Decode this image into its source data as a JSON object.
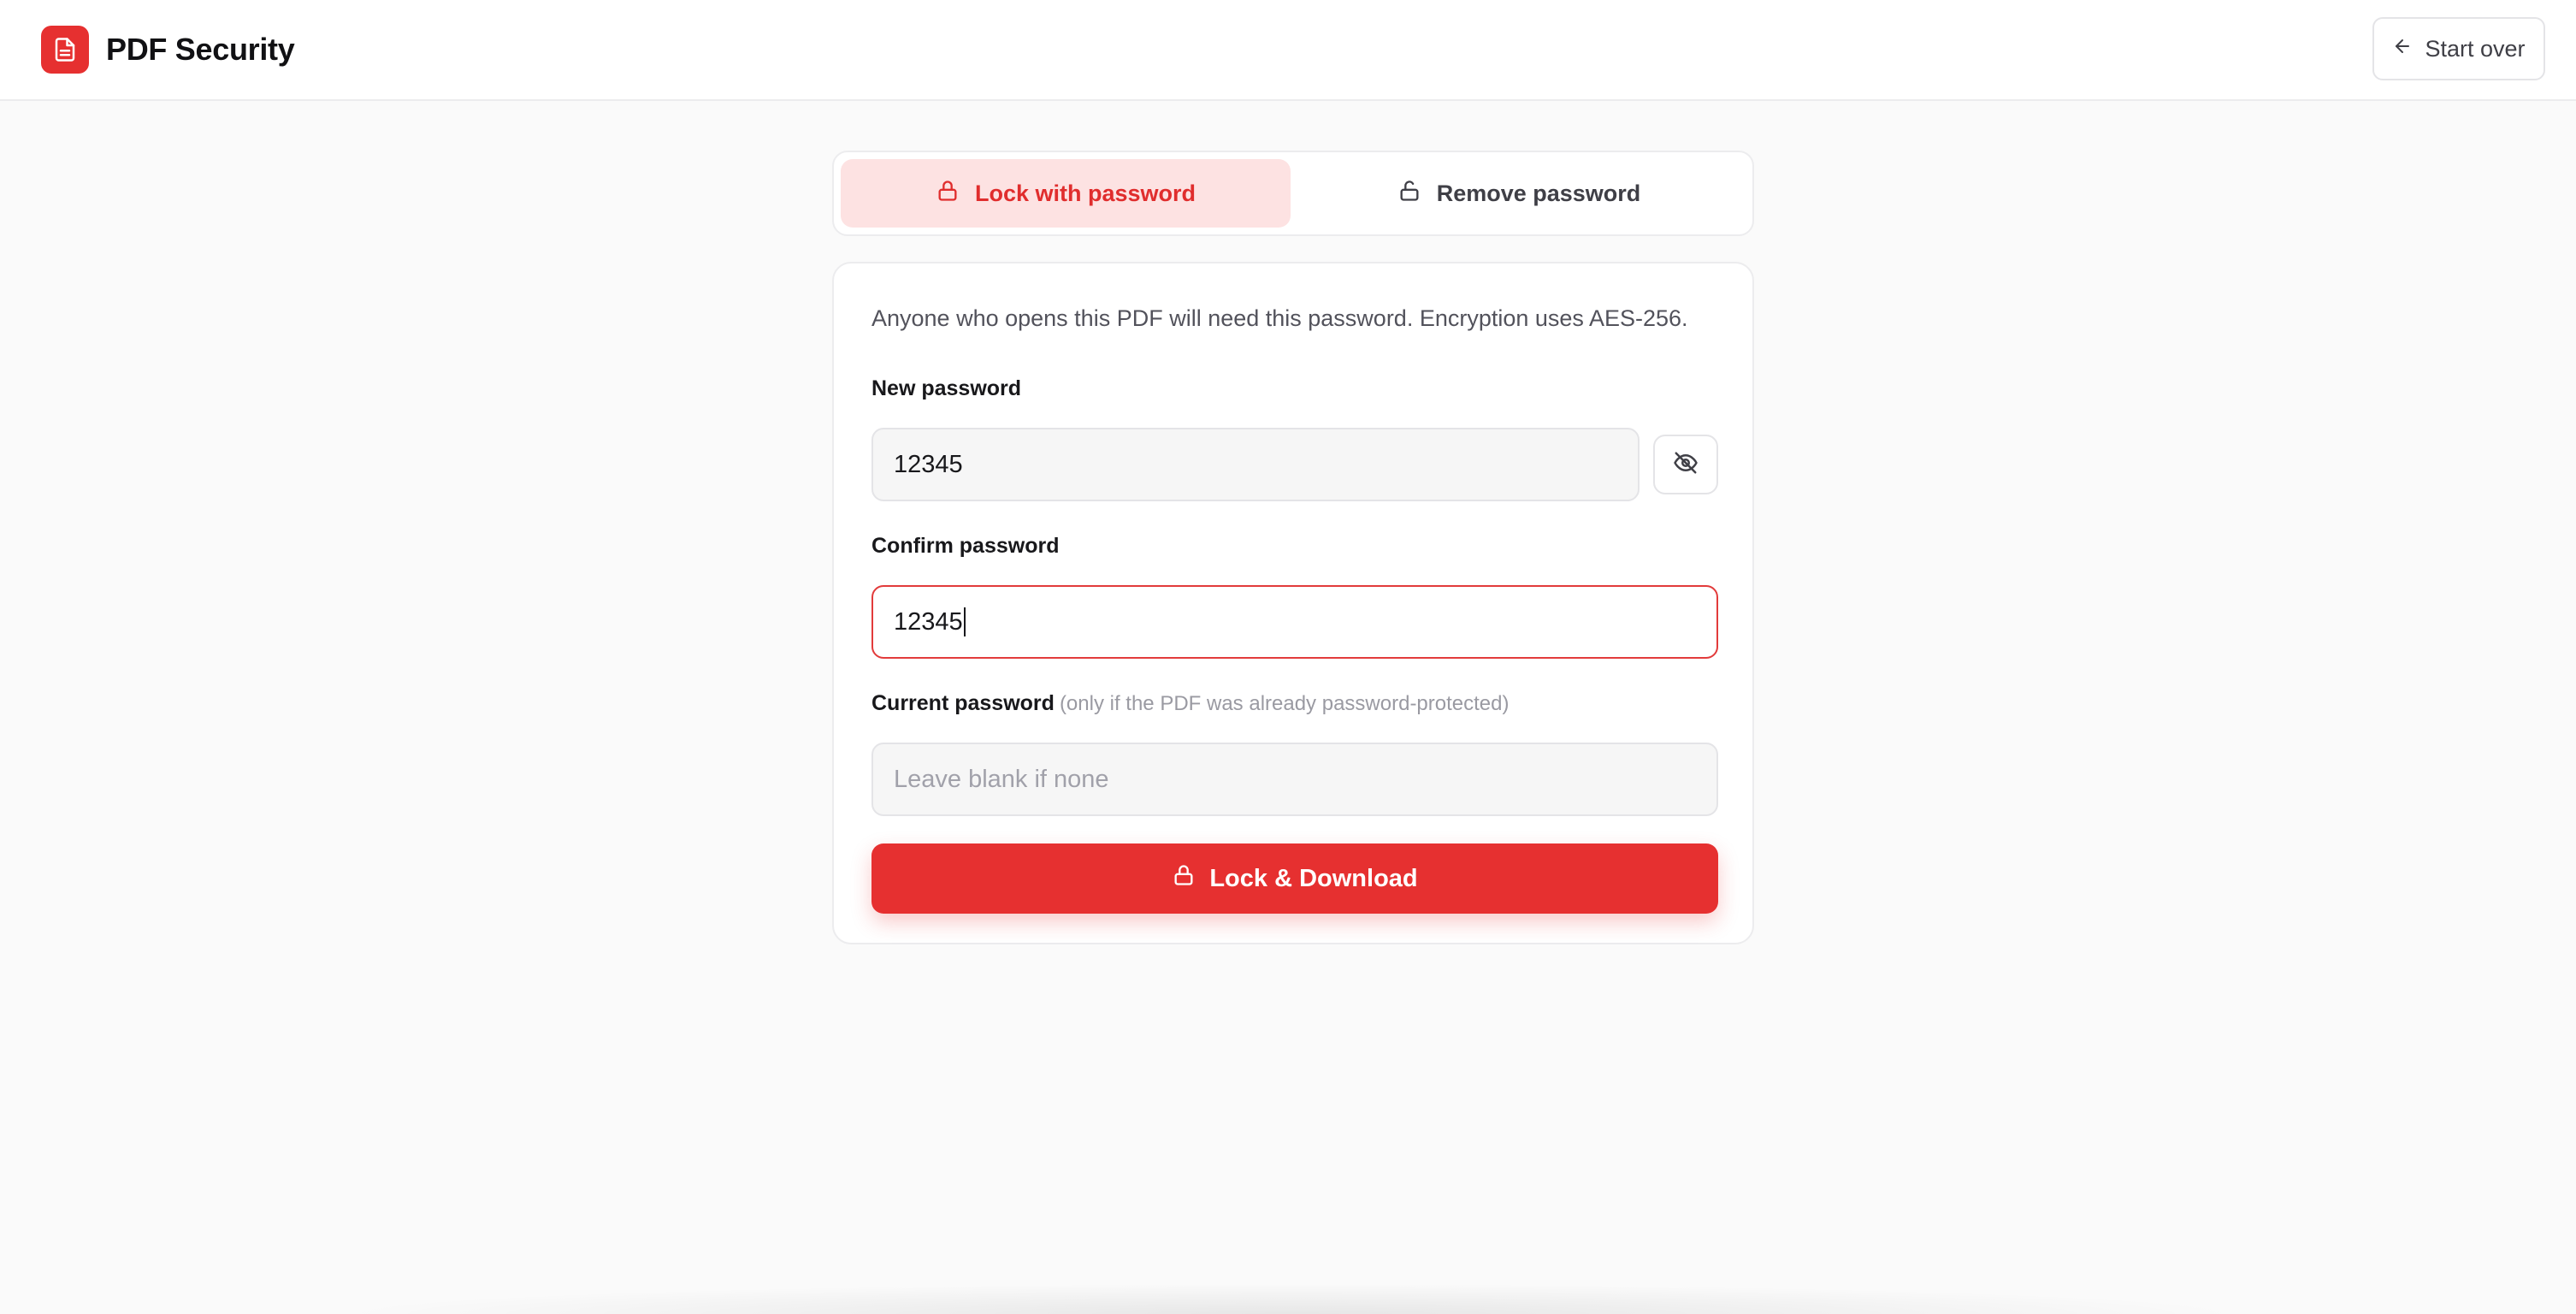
{
  "header": {
    "title": "PDF Security",
    "logo_icon": "file-text-icon",
    "start_over_label": "Start over",
    "start_over_icon": "arrow-left-icon"
  },
  "tabs": [
    {
      "label": "Lock with password",
      "icon": "lock-icon",
      "active": true
    },
    {
      "label": "Remove password",
      "icon": "unlock-icon",
      "active": false
    }
  ],
  "form": {
    "description": "Anyone who opens this PDF will need this password. Encryption uses AES-256.",
    "new_password": {
      "label": "New password",
      "value": "12345",
      "toggle_icon": "eye-off-icon"
    },
    "confirm_password": {
      "label": "Confirm password",
      "value": "12345"
    },
    "current_password": {
      "label": "Current password",
      "hint": "(only if the PDF was already password-protected)",
      "placeholder": "Leave blank if none",
      "value": ""
    },
    "submit_label": "Lock & Download",
    "submit_icon": "lock-icon"
  },
  "colors": {
    "accent": "#e63030",
    "active_tab_bg": "#fde2e2",
    "background": "#fafafa"
  }
}
